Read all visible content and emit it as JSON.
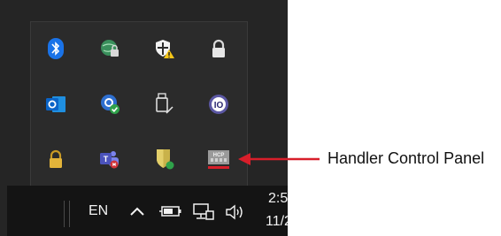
{
  "taskbar": {
    "language": "EN",
    "clock_time": "2:5",
    "clock_date": "11/2"
  },
  "tray_icons": [
    {
      "name": "bluetooth-icon"
    },
    {
      "name": "network-globe-lock-icon"
    },
    {
      "name": "security-shield-warning-icon"
    },
    {
      "name": "padlock-icon"
    },
    {
      "name": "outlook-icon"
    },
    {
      "name": "sync-check-icon"
    },
    {
      "name": "usb-eject-icon"
    },
    {
      "name": "io-icon"
    },
    {
      "name": "padlock-gold-icon"
    },
    {
      "name": "teams-icon"
    },
    {
      "name": "antivirus-shield-icon"
    },
    {
      "name": "handler-control-panel-icon"
    }
  ],
  "callout": {
    "label": "Handler Control Panel",
    "color": "#d81e2a"
  }
}
